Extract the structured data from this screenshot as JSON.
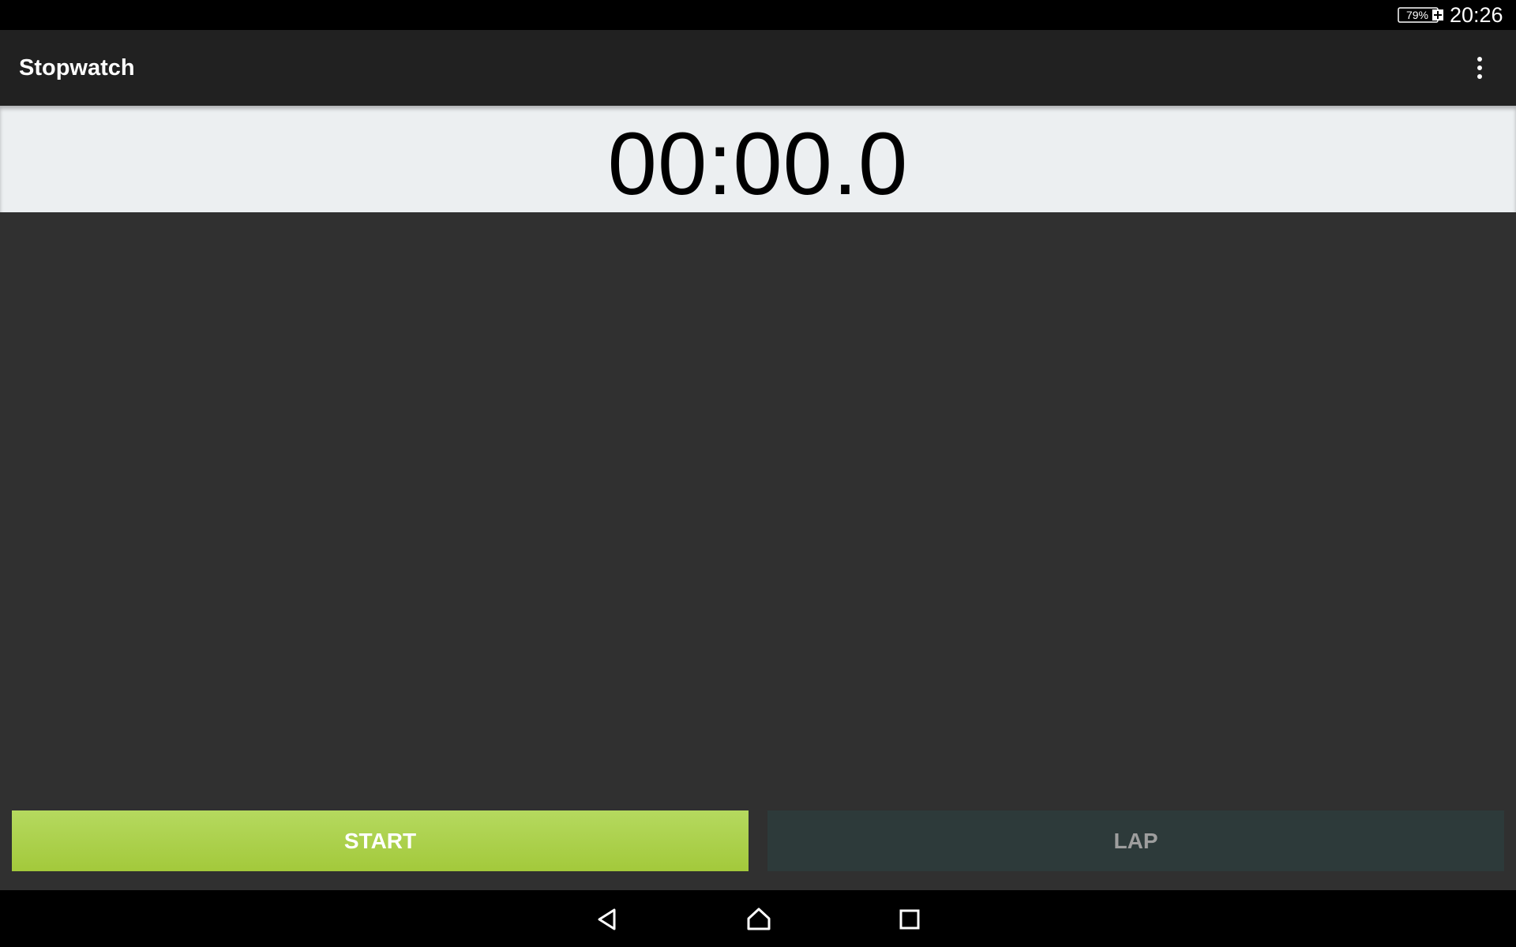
{
  "status_bar": {
    "battery_level": "79%",
    "time": "20:26"
  },
  "app_bar": {
    "title": "Stopwatch",
    "menu_icon": "more-vert-icon"
  },
  "timer": {
    "display": "00:00.0"
  },
  "buttons": {
    "start_label": "START",
    "lap_label": "LAP"
  },
  "nav_bar": {
    "back_icon": "back-triangle-icon",
    "home_icon": "home-icon",
    "recents_icon": "recents-square-icon"
  },
  "colors": {
    "start_button": "#a3c93b",
    "lap_button": "#2d3a3a",
    "timer_background": "#eceff1",
    "app_bar": "#212121",
    "content_background": "#303030"
  },
  "laps": []
}
